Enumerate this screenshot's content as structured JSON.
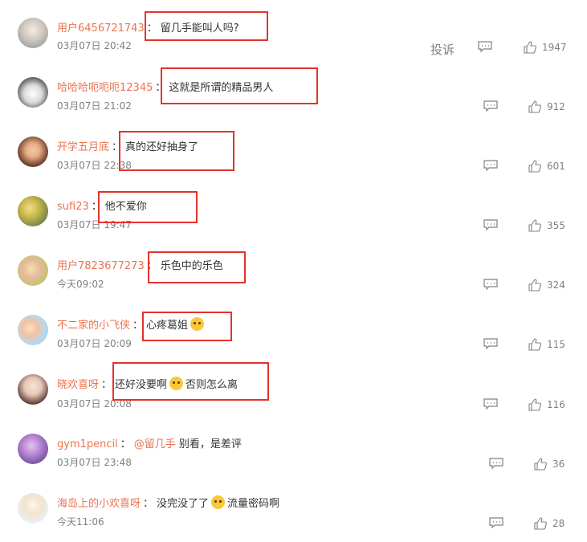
{
  "actions": {
    "report_label": "投诉"
  },
  "comments": [
    {
      "username": "用户6456721743",
      "colon": "：",
      "text": "留几手能叫人吗?",
      "time": "03月07日 20:42",
      "likes": "1947"
    },
    {
      "username": "哈哈哈呃呃呃12345",
      "colon": "：",
      "text": "这就是所谓的精品男人",
      "time": "03月07日 21:02",
      "likes": "912"
    },
    {
      "username": "开学五月底",
      "colon": "：",
      "text": "真的还好抽身了",
      "time": "03月07日 22:38",
      "likes": "601"
    },
    {
      "username": "sufi23",
      "colon": "：",
      "text": "他不爱你",
      "time": "03月07日 19:47",
      "likes": "355"
    },
    {
      "username": "用户7823677273",
      "colon": "：",
      "text": "乐色中的乐色",
      "time": "今天09:02",
      "likes": "324"
    },
    {
      "username": "不二家的小飞侠",
      "colon": "：",
      "text": "心疼葛姐",
      "emoji": "crying-face",
      "time": "03月07日 20:09",
      "likes": "115"
    },
    {
      "username": "晓欢喜呀",
      "colon": "：",
      "text": "还好没要啊",
      "emoji": "laughing-face",
      "text2": "否则怎么离",
      "time": "03月07日 20:08",
      "likes": "116"
    },
    {
      "username": "gym1pencil",
      "colon": "：",
      "mention": "@留几手",
      "text": "别看，是差评",
      "time": "03月07日 23:48",
      "likes": "36"
    },
    {
      "username": "海岛上的小欢喜呀",
      "colon": "：",
      "text": "没完没了了",
      "emoji": "shrug-emoji",
      "text2": "流量密码啊",
      "time": "今天11:06",
      "likes": "28"
    }
  ],
  "colors": {
    "username": "#eb7350",
    "highlight_box": "#e4322b",
    "meta_gray": "#808080"
  }
}
